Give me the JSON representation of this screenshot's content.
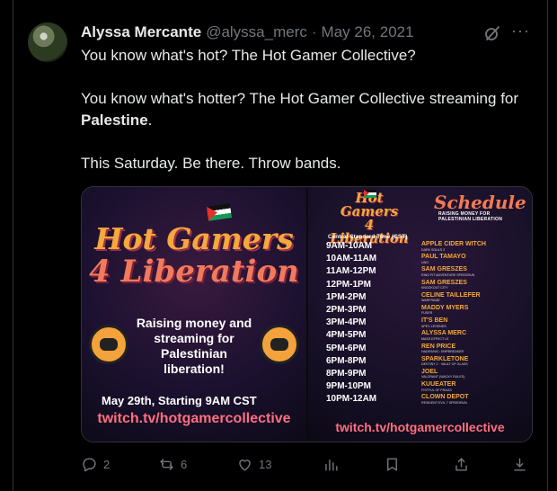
{
  "tweet": {
    "author_name": "Alyssa Mercante",
    "handle": "@alyssa_merc",
    "separator": "·",
    "date": "May 26, 2021",
    "lines": [
      "You know what's hot? The Hot Gamer Collective?",
      "You know what's hotter? The Hot Gamer Collective streaming for",
      "Palestine",
      ".",
      "This Saturday. Be there. Throw bands."
    ]
  },
  "media": {
    "left": {
      "brand_line1": "Hot Gamers",
      "brand_line2": "4 Liberation",
      "raising_text": "Raising money and streaming for Palestinian liberation!",
      "date_text": "May 29th, Starting 9AM CST",
      "url": "twitch.tv/hotgamercollective"
    },
    "right": {
      "brand_line1": "Hot Gamers",
      "brand_line2": "4 Liberation",
      "schedule_title": "Schedule",
      "schedule_subtitle": "RAISING MONEY FOR PALESTINIAN LIBERATION",
      "timezone": "Central Standard Time (CST)",
      "url": "twitch.tv/hotgamercollective",
      "rows": [
        {
          "time": "9AM-10AM",
          "name": "APPLE CIDER WITCH",
          "game": "DARK SOULS 2"
        },
        {
          "time": "10AM-11AM",
          "name": "PAUL TAMAYO",
          "game": "UNO"
        },
        {
          "time": "11AM-12PM",
          "name": "SAM GRESZES",
          "game": "RING FIT ADVENTURE SPEEDRUN"
        },
        {
          "time": "12PM-1PM",
          "name": "SAM GRESZES",
          "game": "KNOCKOUT CITY"
        },
        {
          "time": "1PM-2PM",
          "name": "CELINE TAILLEFER",
          "game": "WARFRAME"
        },
        {
          "time": "2PM-3PM",
          "name": "MADDY MYERS",
          "game": "FUSER"
        },
        {
          "time": "3PM-4PM",
          "name": "IT'S BEN",
          "game": "APEX LEGENDS"
        },
        {
          "time": "4PM-5PM",
          "name": "ALYSSA MERC",
          "game": "MASS EFFECT LE"
        },
        {
          "time": "5PM-6PM",
          "name": "REN PRICE",
          "game": "HADES/NIC: SHIPBREAKER"
        },
        {
          "time": "6PM-8PM",
          "name": "SPARKLETONE",
          "game": "DESTINY 2 · VAULT OF GLASS"
        },
        {
          "time": "8PM-9PM",
          "name": "JOEL",
          "game": "VALORANT (WACKY RULES)"
        },
        {
          "time": "9PM-10PM",
          "name": "KUUEATER",
          "game": "FISTFUL OF FRAGS"
        },
        {
          "time": "10PM-12AM",
          "name": "CLOWN DEPOT",
          "game": "RESIDENT EVIL 7 SPEEDRUN"
        }
      ]
    }
  },
  "actions": {
    "reply_count": "2",
    "retweet_count": "6",
    "like_count": "13"
  }
}
